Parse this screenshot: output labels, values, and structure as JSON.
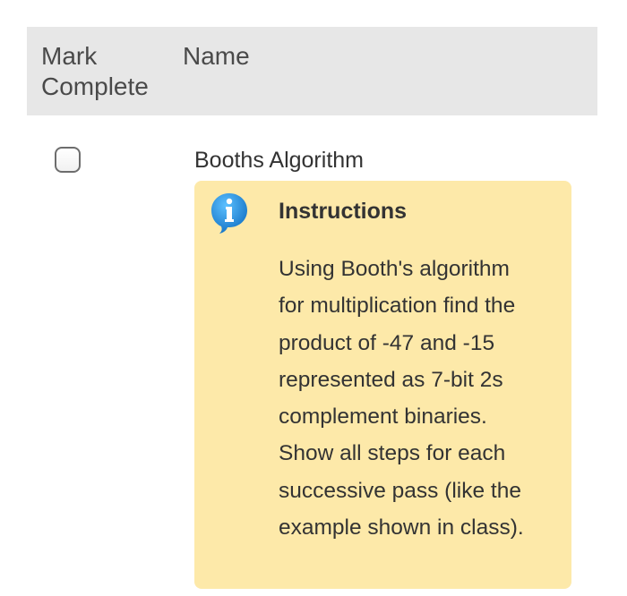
{
  "table": {
    "headers": {
      "mark_complete": "Mark Complete",
      "name": "Name"
    },
    "rows": [
      {
        "completed": false,
        "name": "Booths Algorithm",
        "instructions": {
          "title": "Instructions",
          "lines": [
            "Using Booth's algorithm",
            "for multiplication find the",
            "product of -47 and -15",
            "represented as 7-bit 2s",
            "complement binaries.",
            "Show all steps for each",
            "successive pass (like the",
            "example shown in class)."
          ]
        }
      }
    ]
  },
  "icons": {
    "info": "info-icon"
  },
  "colors": {
    "header_bg": "#e7e7e7",
    "instructions_bg": "#fde9a9",
    "info_icon": "#1e8fdc"
  }
}
